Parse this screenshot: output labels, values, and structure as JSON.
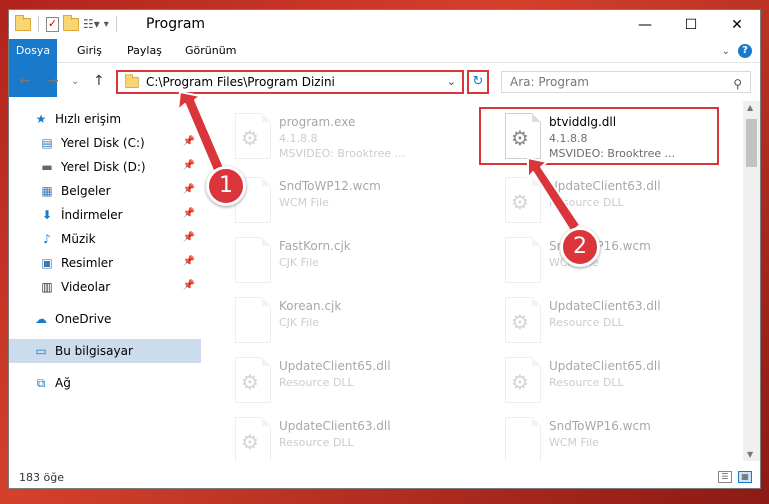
{
  "window": {
    "title": "Program"
  },
  "ribbon": {
    "tabs": [
      "Dosya",
      "Giriş",
      "Paylaş",
      "Görünüm"
    ],
    "help": "?"
  },
  "nav": {
    "address": "C:\\Program Files\\Program Dizini",
    "search_placeholder": "Ara: Program"
  },
  "sidebar": {
    "quick_access": "Hızlı erişim",
    "items": [
      {
        "label": "Yerel Disk (C:)",
        "icon": "drive-icon"
      },
      {
        "label": "Yerel Disk (D:)",
        "icon": "drive-icon"
      },
      {
        "label": "Belgeler",
        "icon": "documents-icon"
      },
      {
        "label": "İndirmeler",
        "icon": "download-icon"
      },
      {
        "label": "Müzik",
        "icon": "music-icon"
      },
      {
        "label": "Resimler",
        "icon": "pictures-icon"
      },
      {
        "label": "Videolar",
        "icon": "videos-icon"
      }
    ],
    "onedrive": "OneDrive",
    "this_pc": "Bu bilgisayar",
    "network": "Ağ"
  },
  "files": [
    {
      "name": "program.exe",
      "meta1": "4.1.8.8",
      "meta2": "MSVIDEO: Brooktree ...",
      "faded": true
    },
    {
      "name": "btviddlg.dll",
      "meta1": "4.1.8.8",
      "meta2": "MSVIDEO: Brooktree ...",
      "faded": false
    },
    {
      "name": "SndToWP12.wcm",
      "meta1": "WCM File",
      "meta2": "",
      "faded": true
    },
    {
      "name": "UpdateClient63.dll",
      "meta1": "Resource DLL",
      "meta2": "",
      "faded": true
    },
    {
      "name": "FastKorn.cjk",
      "meta1": "CJK File",
      "meta2": "",
      "faded": true
    },
    {
      "name": "SndToWP16.wcm",
      "meta1": "WCM File",
      "meta2": "",
      "faded": true
    },
    {
      "name": "Korean.cjk",
      "meta1": "CJK File",
      "meta2": "",
      "faded": true
    },
    {
      "name": "UpdateClient63.dll",
      "meta1": "Resource DLL",
      "meta2": "",
      "faded": true
    },
    {
      "name": "UpdateClient65.dll",
      "meta1": "Resource DLL",
      "meta2": "",
      "faded": true
    },
    {
      "name": "UpdateClient65.dll",
      "meta1": "Resource DLL",
      "meta2": "",
      "faded": true
    },
    {
      "name": "UpdateClient63.dll",
      "meta1": "Resource DLL",
      "meta2": "",
      "faded": true
    },
    {
      "name": "SndToWP16.wcm",
      "meta1": "WCM File",
      "meta2": "",
      "faded": true
    }
  ],
  "status": {
    "count": "183 öğe"
  },
  "callouts": [
    "1",
    "2"
  ],
  "colors": {
    "accent": "#1979ca",
    "highlight": "#d9353b"
  }
}
